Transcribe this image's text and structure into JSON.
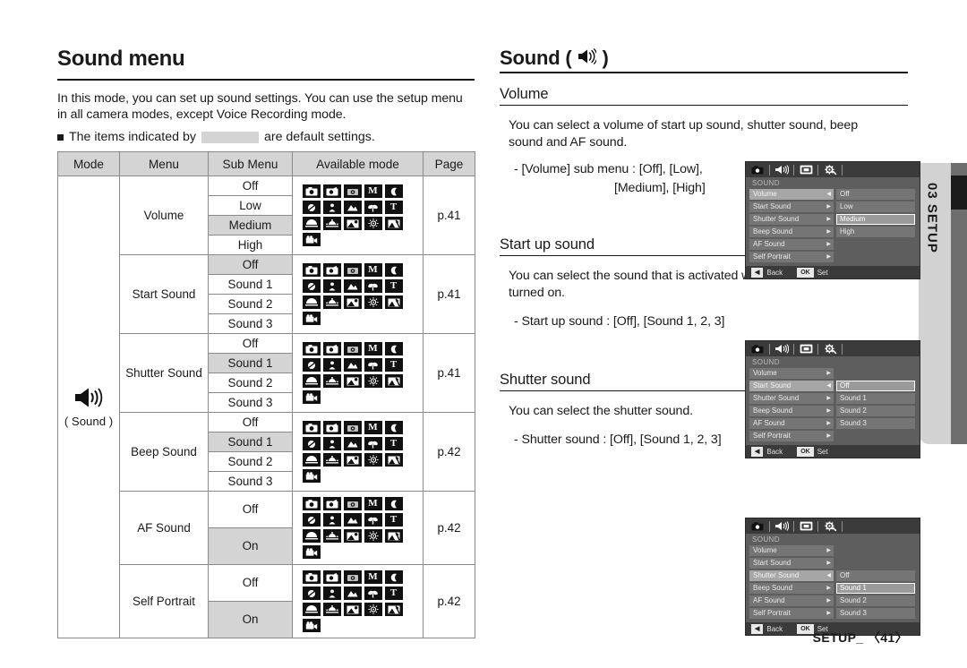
{
  "page": {
    "title": "Sound menu",
    "intro_line1": "In this mode, you can set up sound settings. You can use the setup menu",
    "intro_line2": "in all camera modes, except Voice Recording mode.",
    "bullet_prefix": "The items indicated by",
    "bullet_suffix": "are default settings.",
    "footer": "SETUP_ 〈41〉",
    "side_tab": "03 SETUP"
  },
  "table": {
    "headers": [
      "Mode",
      "Menu",
      "Sub Menu",
      "Available mode",
      "Page"
    ],
    "mode_label": "( Sound )",
    "mode_icon": "speaker-icon",
    "groups": [
      {
        "menu": "Volume",
        "page": "p.41",
        "submenus": [
          {
            "label": "Off",
            "default": false
          },
          {
            "label": "Low",
            "default": false
          },
          {
            "label": "Medium",
            "default": true
          },
          {
            "label": "High",
            "default": false
          }
        ]
      },
      {
        "menu": "Start Sound",
        "page": "p.41",
        "submenus": [
          {
            "label": "Off",
            "default": true
          },
          {
            "label": "Sound 1",
            "default": false
          },
          {
            "label": "Sound 2",
            "default": false
          },
          {
            "label": "Sound 3",
            "default": false
          }
        ]
      },
      {
        "menu": "Shutter Sound",
        "page": "p.41",
        "submenus": [
          {
            "label": "Off",
            "default": false
          },
          {
            "label": "Sound 1",
            "default": true
          },
          {
            "label": "Sound 2",
            "default": false
          },
          {
            "label": "Sound 3",
            "default": false
          }
        ]
      },
      {
        "menu": "Beep Sound",
        "page": "p.42",
        "submenus": [
          {
            "label": "Off",
            "default": false
          },
          {
            "label": "Sound 1",
            "default": true
          },
          {
            "label": "Sound 2",
            "default": false
          },
          {
            "label": "Sound 3",
            "default": false
          }
        ]
      },
      {
        "menu": "AF Sound",
        "page": "p.42",
        "submenus": [
          {
            "label": "Off",
            "default": false
          },
          {
            "label": "On",
            "default": true
          }
        ]
      },
      {
        "menu": "Self Portrait",
        "page": "p.42",
        "submenus": [
          {
            "label": "Off",
            "default": false
          },
          {
            "label": "On",
            "default": true
          }
        ]
      }
    ],
    "available_mode_icons": [
      "camera-auto-icon",
      "program-icon",
      "dual-is-icon",
      "manual-M-icon",
      "night-icon",
      "portrait-icon",
      "children-icon",
      "landscape-icon",
      "close-up-icon",
      "text-T-icon",
      "sunset-icon",
      "dawn-icon",
      "backlight-icon",
      "fireworks-icon",
      "beach-snow-icon",
      "movie-icon"
    ]
  },
  "right": {
    "section_title": "Sound (",
    "section_title_end": ")",
    "section_icon": "speaker-icon",
    "volume": {
      "heading": "Volume",
      "body": "You can select a volume of start up sound, shutter sound, beep sound and AF sound.",
      "option_line1": "- [Volume] sub menu : [Off], [Low],",
      "option_line2": "[Medium], [High]"
    },
    "startup": {
      "heading": "Start up sound",
      "body": "You can select the sound that is activated whenever the camera is turned on.",
      "option_line1": "- Start up sound : [Off], [Sound 1, 2, 3]"
    },
    "shutter": {
      "heading": "Shutter sound",
      "body": "You can select the shutter sound.",
      "option_line1": "- Shutter sound : [Off], [Sound 1, 2, 3]"
    }
  },
  "lcd": {
    "tab_icons": [
      "camera-tab-icon",
      "sound-tab-icon",
      "display-tab-icon",
      "setup-gear-tab-icon"
    ],
    "header": "SOUND",
    "back_key": "◀",
    "back_label": "Back",
    "ok_key": "OK",
    "ok_label": "Set",
    "screens": [
      {
        "id": "volume-screen",
        "menu_rows": [
          {
            "label": "Volume",
            "selected": true,
            "arrow": "◀"
          },
          {
            "label": "Start Sound",
            "selected": false,
            "arrow": "▶"
          },
          {
            "label": "Shutter Sound",
            "selected": false,
            "arrow": "▶"
          },
          {
            "label": "Beep Sound",
            "selected": false,
            "arrow": "▶"
          },
          {
            "label": "AF Sound",
            "selected": false,
            "arrow": "▶"
          },
          {
            "label": "Self Portrait",
            "selected": false,
            "arrow": "▶"
          }
        ],
        "options": [
          {
            "label": "Off",
            "highlighted": false
          },
          {
            "label": "Low",
            "highlighted": false
          },
          {
            "label": "Medium",
            "highlighted": true
          },
          {
            "label": "High",
            "highlighted": false
          },
          {
            "label": "",
            "highlighted": false,
            "blank": true
          },
          {
            "label": "",
            "highlighted": false,
            "blank": true
          }
        ]
      },
      {
        "id": "start-sound-screen",
        "menu_rows": [
          {
            "label": "Volume",
            "selected": false,
            "arrow": "▶"
          },
          {
            "label": "Start Sound",
            "selected": true,
            "arrow": "◀"
          },
          {
            "label": "Shutter Sound",
            "selected": false,
            "arrow": "▶"
          },
          {
            "label": "Beep Sound",
            "selected": false,
            "arrow": "▶"
          },
          {
            "label": "AF Sound",
            "selected": false,
            "arrow": "▶"
          },
          {
            "label": "Self Portrait",
            "selected": false,
            "arrow": "▶"
          }
        ],
        "options": [
          {
            "label": "",
            "highlighted": false,
            "blank": true
          },
          {
            "label": "Off",
            "highlighted": true
          },
          {
            "label": "Sound 1",
            "highlighted": false
          },
          {
            "label": "Sound 2",
            "highlighted": false
          },
          {
            "label": "Sound 3",
            "highlighted": false
          },
          {
            "label": "",
            "highlighted": false,
            "blank": true
          }
        ]
      },
      {
        "id": "shutter-sound-screen",
        "menu_rows": [
          {
            "label": "Volume",
            "selected": false,
            "arrow": "▶"
          },
          {
            "label": "Start Sound",
            "selected": false,
            "arrow": "▶"
          },
          {
            "label": "Shutter Sound",
            "selected": true,
            "arrow": "◀"
          },
          {
            "label": "Beep Sound",
            "selected": false,
            "arrow": "▶"
          },
          {
            "label": "AF Sound",
            "selected": false,
            "arrow": "▶"
          },
          {
            "label": "Self Portrait",
            "selected": false,
            "arrow": "▶"
          }
        ],
        "options": [
          {
            "label": "",
            "highlighted": false,
            "blank": true
          },
          {
            "label": "",
            "highlighted": false,
            "blank": true
          },
          {
            "label": "Off",
            "highlighted": false
          },
          {
            "label": "Sound 1",
            "highlighted": true
          },
          {
            "label": "Sound 2",
            "highlighted": false
          },
          {
            "label": "Sound 3",
            "highlighted": false
          }
        ]
      }
    ]
  },
  "colors": {
    "shade": "#d4d4d4",
    "rule": "#1a1a1a",
    "lcd_bg": "#5e5e5e"
  }
}
